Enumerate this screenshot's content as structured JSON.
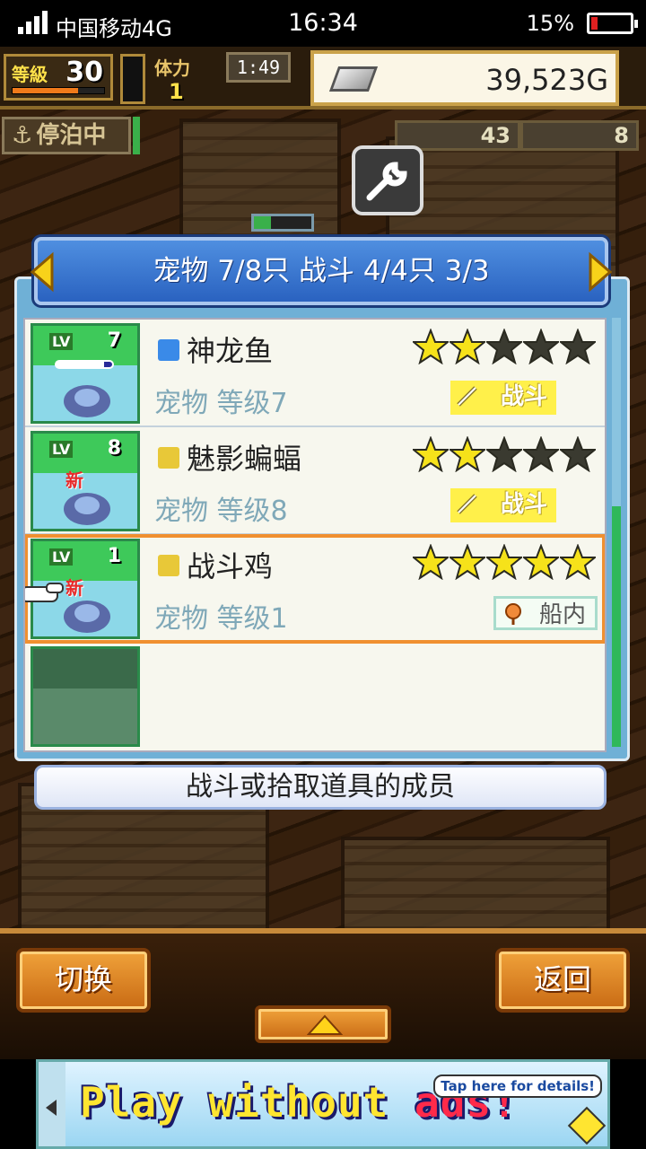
{
  "status": {
    "carrier": "中国移动4G",
    "time": "16:34",
    "battery": "15%",
    "battery_level": 0.15
  },
  "hud": {
    "level_label": "等級",
    "level": "30",
    "xp_fraction": 0.72,
    "stamina_label": "体力",
    "stamina": "1",
    "timer": "1:49",
    "gold": "39,523G",
    "mooring": "停泊中",
    "res1": "43",
    "res2": "8"
  },
  "panel": {
    "title": "宠物 7/8只 战斗 4/4只  3/3",
    "footer": "战斗或拾取道具的成员",
    "rows": [
      {
        "lv_label": "LV",
        "lv": "7",
        "new": "",
        "xp_fraction": 0.85,
        "element_color": "#3a8ae8",
        "name": "神龙鱼",
        "subtitle": "宠物 等级7",
        "stars": 2,
        "badge": "战斗",
        "badge_type": "battle",
        "selected": false
      },
      {
        "lv_label": "LV",
        "lv": "8",
        "new": "新",
        "element_color": "#e8c838",
        "name": "魅影蝙蝠",
        "subtitle": "宠物 等级8",
        "stars": 2,
        "badge": "战斗",
        "badge_type": "battle",
        "selected": false
      },
      {
        "lv_label": "LV",
        "lv": "1",
        "new": "新",
        "element_color": "#e8c838",
        "name": "战斗鸡",
        "subtitle": "宠物 等级1",
        "stars": 5,
        "badge": "船内",
        "badge_type": "ship",
        "selected": true
      }
    ]
  },
  "buttons": {
    "switch": "切换",
    "back": "返回"
  },
  "ad": {
    "text_a": "Play without ",
    "text_b": "ads!",
    "tap": "Tap here for details!"
  },
  "colors": {
    "accent_blue": "#2a62c0",
    "star": "#f6e21a",
    "selection": "#f09030"
  }
}
